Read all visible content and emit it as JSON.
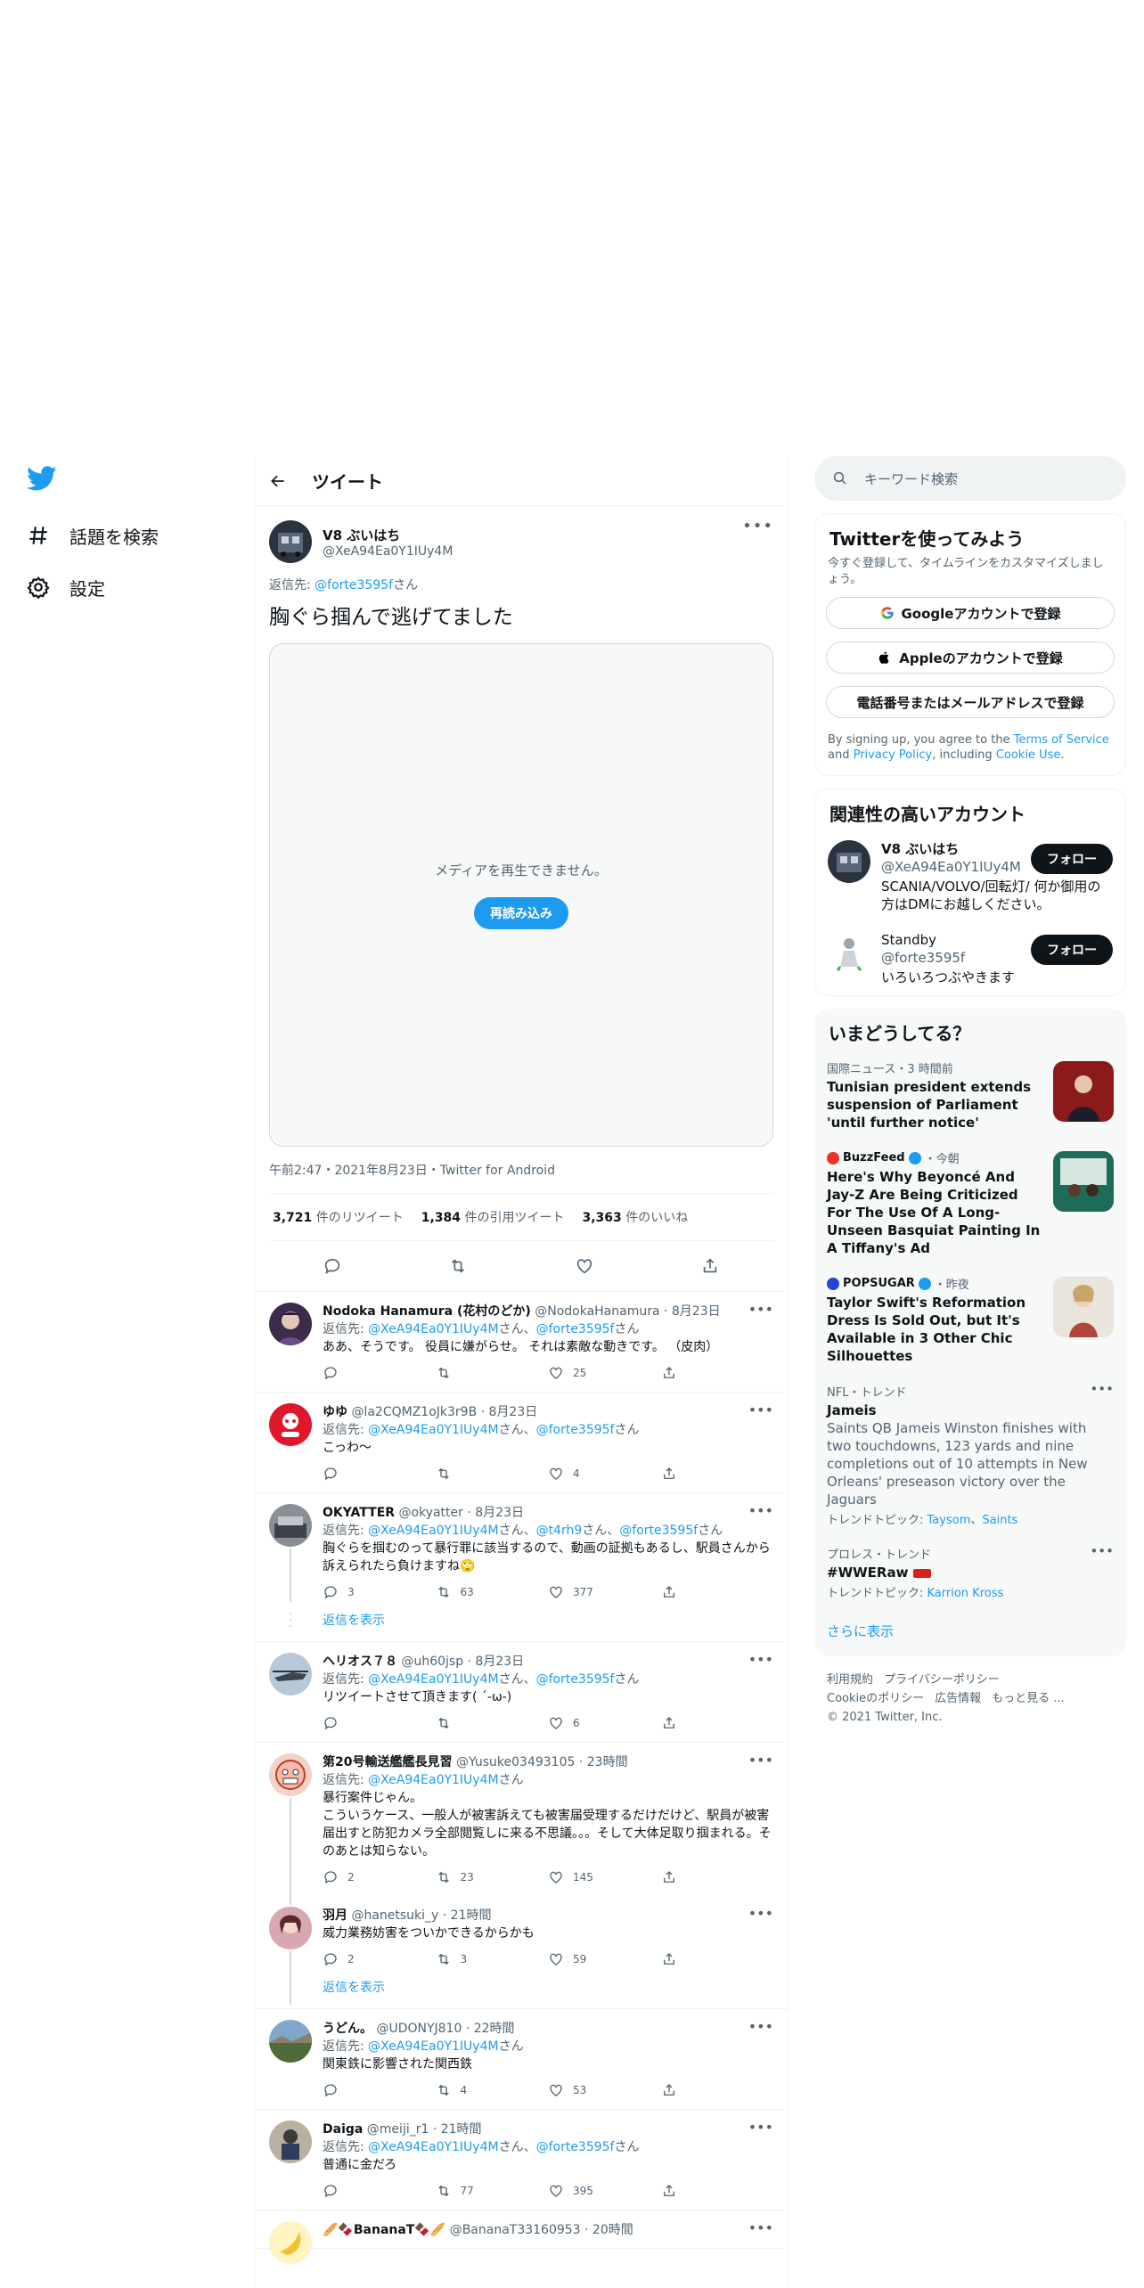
{
  "nav": {
    "explore_label": "話題を検索",
    "settings_label": "設定"
  },
  "header": {
    "title": "ツイート"
  },
  "main_tweet": {
    "name": "V8 ぶいはち",
    "handle": "@XeA94Ea0Y1IUy4M",
    "reply_to_prefix": "返信先: ",
    "reply_to": "@forte3595f",
    "reply_to_suffix": "さん",
    "text": "胸ぐら掴んで逃げてました",
    "media_message": "メディアを再生できません。",
    "reload_label": "再読み込み",
    "meta": "午前2:47・2021年8月23日・Twitter for Android",
    "retweets": "3,721",
    "retweets_label": "件のリツイート",
    "quotes": "1,384",
    "quotes_label": "件の引用ツイート",
    "likes": "3,363",
    "likes_label": "件のいいね"
  },
  "replies": [
    {
      "name": "Nodoka Hanamura (花村のどか)",
      "meta": "@NodokaHanamura · 8月23日",
      "to1": "@XeA94Ea0Y1IUy4M",
      "sep": "さん、",
      "to2": "@forte3595f",
      "suffix": "さん",
      "text": "ああ、そうです。 役員に嫌がらせ。 それは素敵な動きです。 （皮肉）",
      "reply": "",
      "rt": "",
      "like": "25"
    },
    {
      "name": "ゆゆ",
      "meta": "@la2CQMZ1oJk3r9B · 8月23日",
      "to1": "@XeA94Ea0Y1IUy4M",
      "sep": "さん、",
      "to2": "@forte3595f",
      "suffix": "さん",
      "text": "こっわ〜",
      "reply": "",
      "rt": "",
      "like": "4"
    },
    {
      "name": "OKYATTER",
      "meta": "@okyatter · 8月23日",
      "to1": "@XeA94Ea0Y1IUy4M",
      "sep": "さん、",
      "to2": "@t4rh9",
      "sep2": "さん、",
      "to3": "@forte3595f",
      "suffix": "さん",
      "text": "胸ぐらを掴むのって暴行罪に該当するので、動画の証拠もあるし、駅員さんから訴えられたら負けますね🙄",
      "reply": "3",
      "rt": "63",
      "like": "377"
    },
    {
      "name": "ヘリオス７８",
      "meta": "@uh60jsp · 8月23日",
      "to1": "@XeA94Ea0Y1IUy4M",
      "sep": "さん、",
      "to2": "@forte3595f",
      "suffix": "さん",
      "text": "リツイートさせて頂きます( ´-ω-)",
      "reply": "",
      "rt": "",
      "like": "6"
    },
    {
      "name": "第20号輸送艦艦長見習",
      "meta": "@Yusuke03493105 · 23時間",
      "to1": "@XeA94Ea0Y1IUy4M",
      "suffix": "さん",
      "text": "暴行案件じゃん。\nこういうケース、一般人が被害訴えても被害届受理するだけだけど、駅員が被害届出すと防犯カメラ全部閲覧しに来る不思議。。。そして大体足取り掴まれる。そのあとは知らない。",
      "reply": "2",
      "rt": "23",
      "like": "145"
    },
    {
      "name": "羽月",
      "meta": "@hanetsuki_y · 21時間",
      "text": "威力業務妨害をついかできるからかも",
      "reply": "2",
      "rt": "3",
      "like": "59"
    },
    {
      "name": "うどん。",
      "meta": "@UDONYJ810 · 22時間",
      "to1": "@XeA94Ea0Y1IUy4M",
      "suffix": "さん",
      "text": "関東鉄に影響された関西鉄",
      "reply": "",
      "rt": "4",
      "like": "53"
    },
    {
      "name": "Daiga",
      "meta": "@meiji_r1 · 21時間",
      "to1": "@XeA94Ea0Y1IUy4M",
      "sep": "さん、",
      "to2": "@forte3595f",
      "suffix": "さん",
      "text": "普通に金だろ",
      "reply": "",
      "rt": "77",
      "like": "395"
    },
    {
      "name": "🥖🍫BananaT🍫🥖",
      "meta": "@BananaT33160953 · 20時間"
    }
  ],
  "show_replies_label": "返信を表示",
  "search": {
    "placeholder": "キーワード検索"
  },
  "signup": {
    "title": "Twitterを使ってみよう",
    "subtitle": "今すぐ登録して、タイムラインをカスタマイズしましょう。",
    "google": "Googleアカウントで登録",
    "apple": "Appleのアカウントで登録",
    "phone": "電話番号またはメールアドレスで登録",
    "terms_prefix": "By signing up, you agree to the ",
    "terms_link": "Terms of Service",
    "terms_and": " and ",
    "privacy_link": "Privacy Policy",
    "terms_including": ", including ",
    "cookie_link": "Cookie Use",
    "terms_end": "."
  },
  "relevant": {
    "title": "関連性の高いアカウント",
    "accounts": [
      {
        "name": "V8 ぶいはち",
        "handle": "@XeA94Ea0Y1IUy4M",
        "bio": "SCANIA/VOLVO/回転灯/ 何か御用の方はDMにお越しください。",
        "follow": "フォロー"
      },
      {
        "name": "Standby",
        "handle": "@forte3595f",
        "bio": "いろいろつぶやきます",
        "follow": "フォロー"
      }
    ]
  },
  "trends": {
    "title": "いまどうしてる？",
    "items": [
      {
        "meta": "国際ニュース・3 時間前",
        "title": "Tunisian president extends suspension of Parliament 'until further notice'"
      },
      {
        "meta_source": "BuzzFeed",
        "meta_time": "・今朝",
        "title": "Here's Why Beyoncé And Jay-Z Are Being Criticized For The Use Of A Long-Unseen Basquiat Painting In A Tiffany's Ad"
      },
      {
        "meta_source": "POPSUGAR",
        "meta_time": "・昨夜",
        "title": "Taylor Swift's Reformation Dress Is Sold Out, but It's Available in 3 Other Chic Silhouettes"
      },
      {
        "meta": "NFL・トレンド",
        "title": "Jameis",
        "desc": "Saints QB Jameis Winston finishes with two touchdowns, 123 yards and nine completions out of 10 attempts in New Orleans' preseason victory over the Jaguars",
        "topic_label": "トレンドトピック: ",
        "topic1": "Taysom",
        "topic_sep": "、",
        "topic2": "Saints"
      },
      {
        "meta": "プロレス・トレンド",
        "title": "#WWERaw",
        "topic_label": "トレンドトピック: ",
        "topic1": "Karrion Kross"
      }
    ],
    "more": "さらに表示"
  },
  "footer": {
    "terms": "利用規約",
    "privacy": "プライバシーポリシー",
    "cookie": "Cookieのポリシー",
    "ads": "広告情報",
    "more": "もっと見る ...",
    "copyright": "© 2021 Twitter, Inc."
  },
  "colors": {
    "accent": "#1d9bf0",
    "text": "#0f1419",
    "muted": "#536471"
  }
}
